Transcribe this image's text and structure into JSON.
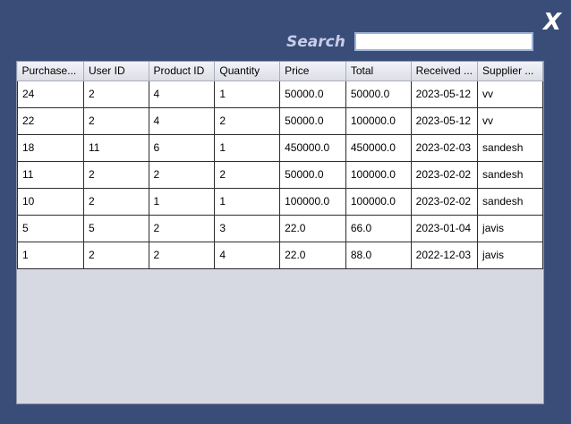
{
  "window": {
    "close_label": "X"
  },
  "search": {
    "label": "Search",
    "value": "",
    "placeholder": ""
  },
  "table": {
    "columns": [
      "Purchase...",
      "User ID",
      "Product ID",
      "Quantity",
      "Price",
      "Total",
      "Received ...",
      "Supplier ..."
    ],
    "rows": [
      [
        "24",
        "2",
        "4",
        "1",
        "50000.0",
        "50000.0",
        "2023-05-12",
        "vv"
      ],
      [
        "22",
        "2",
        "4",
        "2",
        "50000.0",
        "100000.0",
        "2023-05-12",
        "vv"
      ],
      [
        "18",
        "11",
        "6",
        "1",
        "450000.0",
        "450000.0",
        "2023-02-03",
        "sandesh"
      ],
      [
        "11",
        "2",
        "2",
        "2",
        "50000.0",
        "100000.0",
        "2023-02-02",
        "sandesh"
      ],
      [
        "10",
        "2",
        "1",
        "1",
        "100000.0",
        "100000.0",
        "2023-02-02",
        "sandesh"
      ],
      [
        "5",
        "5",
        "2",
        "3",
        "22.0",
        "66.0",
        "2023-01-04",
        "javis"
      ],
      [
        "1",
        "2",
        "2",
        "4",
        "22.0",
        "88.0",
        "2022-12-03",
        "javis"
      ]
    ]
  },
  "colors": {
    "background": "#3a4d78",
    "table_empty_area": "#d6d9e2",
    "search_label": "#c7cce9"
  }
}
